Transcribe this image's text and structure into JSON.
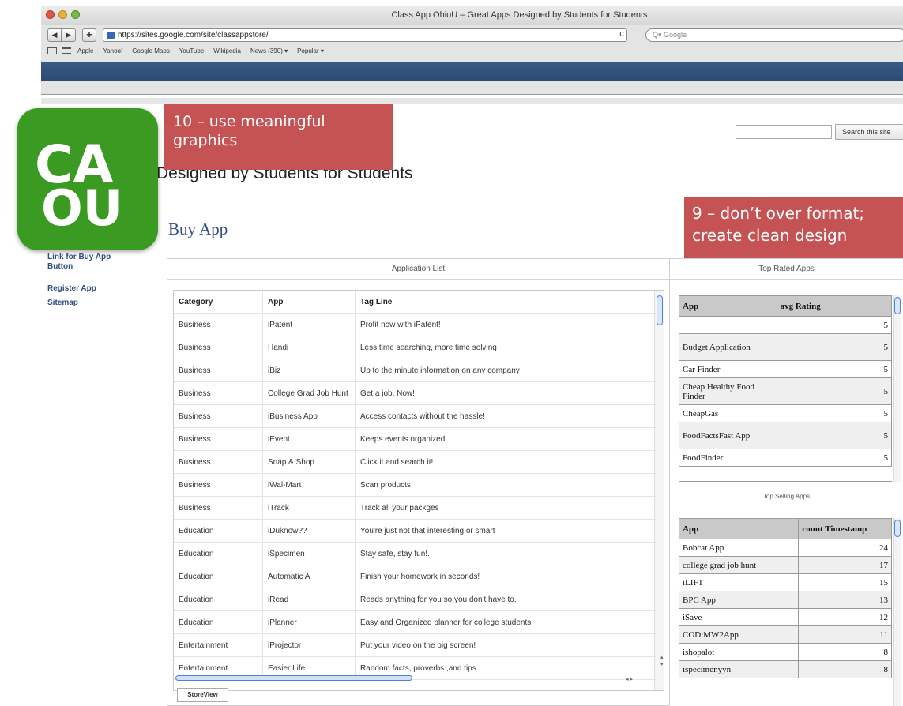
{
  "browser": {
    "window_title": "Class App OhioU – Great Apps Designed by Students for Students",
    "url": "https://sites.google.com/site/classappstore/",
    "search_placeholder": "Google",
    "reload_glyph": "c",
    "bookmarks": [
      "Apple",
      "Yahoo!",
      "Google Maps",
      "YouTube",
      "Wikipedia",
      "News (390) ▾",
      "Popular ▾"
    ]
  },
  "callouts": {
    "graphics": "10 – use meaningful graphics",
    "format": "9 – don’t over format; create clean design"
  },
  "logo": {
    "line1": "CA",
    "line2": "OU",
    "icon": "caou-logo-icon"
  },
  "site": {
    "subtitle": "Designed by Students for Students",
    "page_title": "Buy App",
    "search_button": "Search this site"
  },
  "sidebar": {
    "items": [
      {
        "label": "Link for Buy App Button"
      },
      {
        "label": "Register App"
      },
      {
        "label": "Sitemap"
      }
    ]
  },
  "app_list": {
    "title": "Application List",
    "columns": [
      "Category",
      "App",
      "Tag Line"
    ],
    "rows": [
      [
        "Business",
        "iPatent",
        "Profit now with iPatent!"
      ],
      [
        "Business",
        "Handi",
        "Less time searching, more time solving"
      ],
      [
        "Business",
        "iBiz",
        "Up to the minute information on any company"
      ],
      [
        "Business",
        "College Grad Job Hunt",
        "Get a job, Now!"
      ],
      [
        "Business",
        "iBusiness App",
        "Access contacts without the hassle!"
      ],
      [
        "Business",
        "iEvent",
        "Keeps events organized."
      ],
      [
        "Business",
        "Snap & Shop",
        "Click it and search it!"
      ],
      [
        "Business",
        "iWal-Mart",
        "Scan products"
      ],
      [
        "Business",
        "iTrack",
        "Track all your packges"
      ],
      [
        "Education",
        "iDuknow??",
        "You're just not that interesting or smart"
      ],
      [
        "Education",
        "iSpecimen",
        "Stay safe, stay fun!."
      ],
      [
        "Education",
        "Automatic A",
        "Finish your homework in seconds!"
      ],
      [
        "Education",
        "iRead",
        "Reads anything for you so you don't have to."
      ],
      [
        "Education",
        "iPlanner",
        "Easy and Organized planner for college students"
      ],
      [
        "Entertainment",
        "iProjector",
        "Put your video on the big screen!"
      ],
      [
        "Entertainment",
        "Easier Life",
        "Random facts, proverbs ,and tips"
      ]
    ],
    "sheet_tab": "StoreView"
  },
  "top_rated": {
    "title": "Top Rated Apps",
    "columns": [
      "App",
      "avg Rating"
    ],
    "rows": [
      [
        "",
        "5"
      ],
      [
        "Budget Application",
        "5"
      ],
      [
        "Car Finder",
        "5"
      ],
      [
        "Cheap Healthy Food Finder",
        "5"
      ],
      [
        "CheapGas",
        "5"
      ],
      [
        "FoodFactsFast App",
        "5"
      ],
      [
        "FoodFinder",
        "5"
      ]
    ]
  },
  "top_selling": {
    "title": "Top Selling Apps",
    "columns": [
      "App",
      "count Timestamp"
    ],
    "rows": [
      [
        "Bobcat App",
        "24"
      ],
      [
        "college grad job hunt",
        "17"
      ],
      [
        "iLIFT",
        "15"
      ],
      [
        "BPC App",
        "13"
      ],
      [
        "iSave",
        "12"
      ],
      [
        "COD:MW2App",
        "11"
      ],
      [
        "ishopalot",
        "8"
      ],
      [
        "ispecimenyyn",
        "8"
      ]
    ]
  },
  "colors": {
    "callout": "#c65353",
    "logo_green": "#3a9a22",
    "link_blue": "#2f4d7e",
    "header_blue": "#2b4a74"
  }
}
